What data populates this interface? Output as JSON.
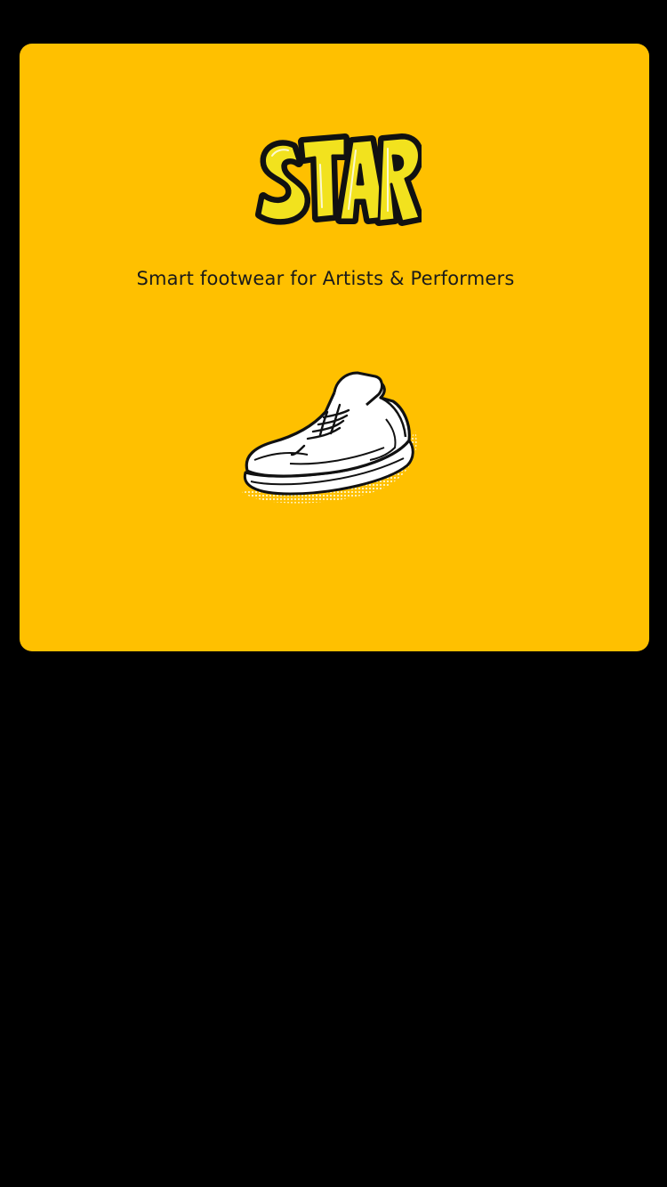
{
  "app": {
    "brand_name": "STAR",
    "tagline": "Smart footwear for Artists & Performers"
  },
  "colors": {
    "background": "#000000",
    "card": "#FFC000",
    "logo_fill": "#F2E21E",
    "outline": "#111111",
    "shoe_fill": "#FFFFFF"
  },
  "icons": {
    "logo": "star-logo",
    "illustration": "sneaker-icon"
  }
}
